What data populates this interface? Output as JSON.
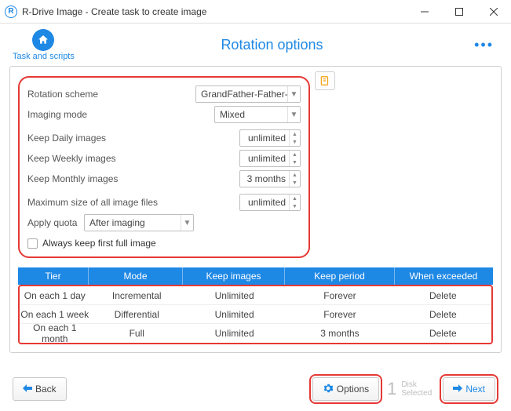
{
  "window": {
    "title": "R-Drive Image - Create task to create image"
  },
  "header": {
    "home_label": "Task and scripts",
    "page_title": "Rotation options"
  },
  "settings": {
    "rotation_scheme_label": "Rotation scheme",
    "rotation_scheme_value": "GrandFather-Father-Son",
    "imaging_mode_label": "Imaging mode",
    "imaging_mode_value": "Mixed",
    "keep_daily_label": "Keep Daily images",
    "keep_daily_value": "unlimited",
    "keep_weekly_label": "Keep Weekly images",
    "keep_weekly_value": "unlimited",
    "keep_monthly_label": "Keep Monthly images",
    "keep_monthly_value": "3 months",
    "max_size_label": "Maximum size of all image files",
    "max_size_value": "unlimited",
    "apply_quota_label": "Apply quota",
    "apply_quota_value": "After imaging",
    "keep_first_label": "Always keep first full image"
  },
  "table": {
    "headers": {
      "tier": "Tier",
      "mode": "Mode",
      "keep_images": "Keep images",
      "keep_period": "Keep period",
      "when_exceeded": "When exceeded"
    },
    "rows": [
      {
        "tier": "On each 1 day",
        "mode": "Incremental",
        "keep_images": "Unlimited",
        "keep_period": "Forever",
        "when_exceeded": "Delete"
      },
      {
        "tier": "On each 1 week",
        "mode": "Differential",
        "keep_images": "Unlimited",
        "keep_period": "Forever",
        "when_exceeded": "Delete"
      },
      {
        "tier": "On each 1 month",
        "mode": "Full",
        "keep_images": "Unlimited",
        "keep_period": "3 months",
        "when_exceeded": "Delete"
      }
    ]
  },
  "footer": {
    "back": "Back",
    "options": "Options",
    "disk_count": "1",
    "disk_label_line1": "Disk",
    "disk_label_line2": "Selected",
    "next": "Next"
  }
}
